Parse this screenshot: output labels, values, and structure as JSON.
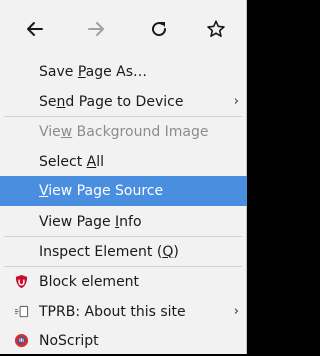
{
  "nav": {
    "back_icon": "arrow-left-icon",
    "forward_icon": "arrow-right-icon",
    "reload_icon": "reload-icon",
    "bookmark_icon": "star-icon"
  },
  "menu": {
    "save_page": {
      "pre": "Save ",
      "u": "P",
      "post": "age As…"
    },
    "send_page": {
      "pre": "Se",
      "u": "n",
      "post": "d Page to Device",
      "arrow": "›"
    },
    "view_bg": {
      "pre": "Vie",
      "u": "w",
      "post": " Background Image"
    },
    "select_all": {
      "pre": "Select ",
      "u": "A",
      "post": "ll"
    },
    "view_source": {
      "pre": "",
      "u": "V",
      "post": "iew Page Source"
    },
    "view_info": {
      "pre": "View Page ",
      "u": "I",
      "post": "nfo"
    },
    "inspect": {
      "pre": "Inspect Element (",
      "u": "Q",
      "post": ")"
    },
    "block_element": {
      "label": "Block element",
      "icon": "ublock-shield-icon"
    },
    "tprb": {
      "label": "TPRB: About this site",
      "arrow": "›",
      "icon": "tprb-icon"
    },
    "noscript": {
      "label": "NoScript",
      "icon": "noscript-icon"
    }
  },
  "colors": {
    "highlight": "#4a8ee0",
    "ublock_red": "#c8102e",
    "noscript_red": "#d62d2d",
    "noscript_blue": "#2a5db0"
  }
}
